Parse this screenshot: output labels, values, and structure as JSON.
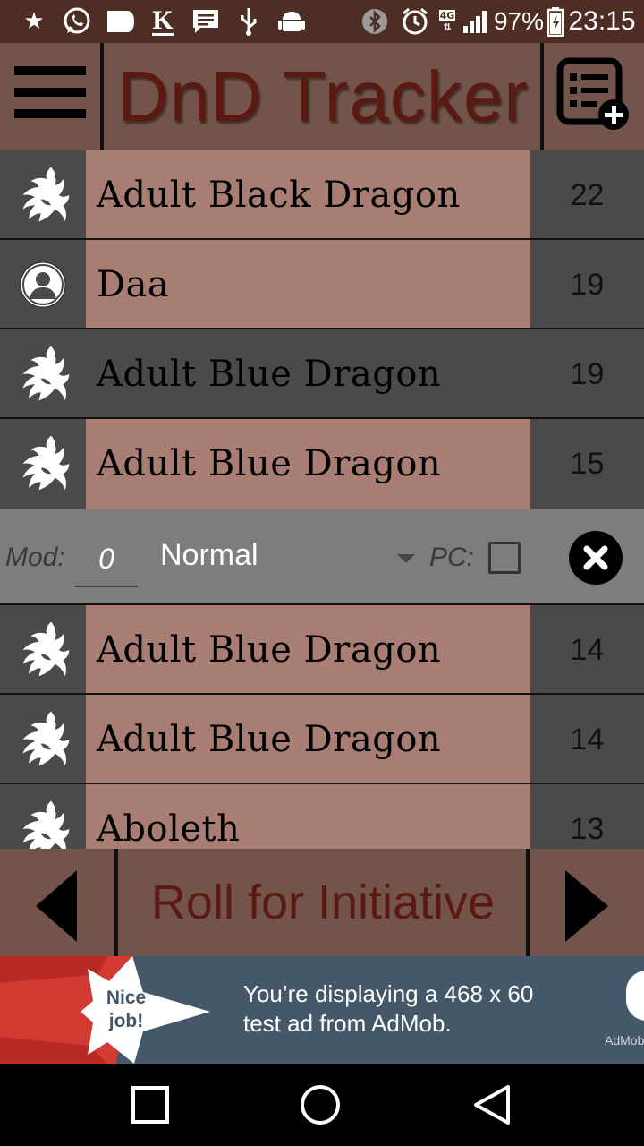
{
  "status_bar": {
    "battery": "97%",
    "time": "23:15",
    "network": "4G",
    "icons": [
      "star-icon",
      "whatsapp-icon",
      "chat-bubble-icon",
      "k-icon",
      "message-icon",
      "usb-icon",
      "android-icon",
      "bluetooth-icon",
      "alarm-icon",
      "signal-icon",
      "battery-icon"
    ]
  },
  "header": {
    "title": "DnD Tracker",
    "menu_icon": "hamburger-menu-icon",
    "add_icon": "list-add-icon"
  },
  "combatants_top": [
    {
      "name": "Adult Black Dragon",
      "initiative": "22",
      "icon": "dragon-icon",
      "highlight": false
    },
    {
      "name": "Daa",
      "initiative": "19",
      "icon": "person-icon",
      "highlight": false
    },
    {
      "name": "Adult Blue Dragon",
      "initiative": "19",
      "icon": "dragon-icon",
      "highlight": true
    },
    {
      "name": "Adult Blue Dragon",
      "initiative": "15",
      "icon": "dragon-icon",
      "highlight": false
    }
  ],
  "mod_bar": {
    "mod_label": "Mod:",
    "mod_value": "0",
    "mode_selected": "Normal",
    "pc_label": "PC:",
    "pc_checked": false
  },
  "combatants_bottom": [
    {
      "name": "Adult Blue Dragon",
      "initiative": "14",
      "icon": "dragon-icon"
    },
    {
      "name": "Adult Blue Dragon",
      "initiative": "14",
      "icon": "dragon-icon"
    },
    {
      "name": "Aboleth",
      "initiative": "13",
      "icon": "dragon-icon"
    }
  ],
  "bottom_bar": {
    "roll_label": "Roll for Initiative"
  },
  "ad": {
    "badge_line1": "Nice",
    "badge_line2": "job!",
    "text_line1": "You’re displaying a 468 x 60",
    "text_line2": "test ad from AdMob.",
    "brand": "AdMob"
  },
  "colors": {
    "header": "#73544a",
    "row_name": "#a87e74",
    "row_dark": "#4a4a4a",
    "title_text": "#5a1a12"
  }
}
